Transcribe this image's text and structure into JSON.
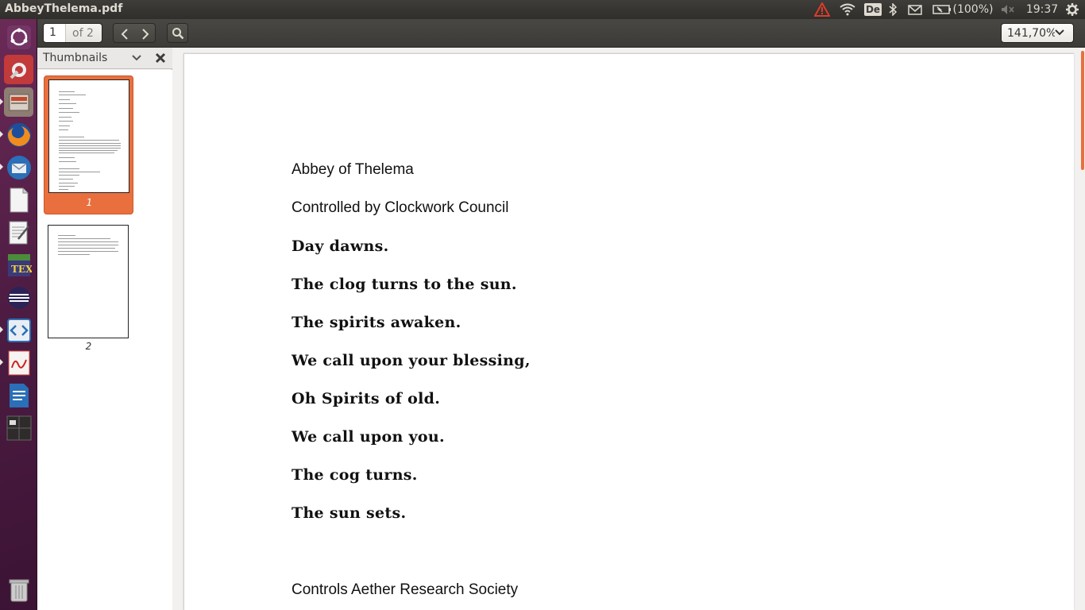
{
  "window": {
    "title": "AbbeyThelema.pdf"
  },
  "panel": {
    "battery_text": "(100%)",
    "keyboard_layout": "De",
    "clock": "19:37",
    "icons": [
      "warning-icon",
      "wifi-icon",
      "keyboard-layout-icon",
      "bluetooth-icon",
      "mail-icon",
      "battery-icon",
      "volume-muted-icon",
      "settings-gear-icon"
    ]
  },
  "launcher": {
    "items": [
      "dash-home",
      "system-settings",
      "file-manager",
      "firefox",
      "thunderbird",
      "libreoffice",
      "text-editor",
      "texmaker",
      "eclipse",
      "code-editor",
      "pdf-viewer",
      "libreoffice-writer",
      "workspace-switcher",
      "trash"
    ]
  },
  "toolbar": {
    "page_current": "1",
    "page_total": "of 2",
    "zoom_value": "141,70%"
  },
  "sidebar": {
    "title": "Thumbnails",
    "thumbnails": [
      {
        "label": "1",
        "selected": true
      },
      {
        "label": "2",
        "selected": false
      }
    ]
  },
  "document": {
    "lines": [
      {
        "text": "Abbey of Thelema",
        "style": "plain"
      },
      {
        "text": "Controlled by Clockwork Council",
        "style": "plain"
      },
      {
        "text": "Day dawns.",
        "style": "gothic"
      },
      {
        "text": "The clog turns to the sun.",
        "style": "gothic"
      },
      {
        "text": "The spirits awaken.",
        "style": "gothic"
      },
      {
        "text": "We call upon your blessing,",
        "style": "gothic"
      },
      {
        "text": "Oh Spirits of old.",
        "style": "gothic"
      },
      {
        "text": "We call upon you.",
        "style": "gothic"
      },
      {
        "text": "The cog turns.",
        "style": "gothic"
      },
      {
        "text": "The sun sets.",
        "style": "gothic"
      },
      {
        "text": "Controls Aether Research Society",
        "style": "plain"
      }
    ]
  },
  "colors": {
    "accent": "#e9703e",
    "panel": "#3c3b37",
    "launcher": "#5a2150"
  }
}
